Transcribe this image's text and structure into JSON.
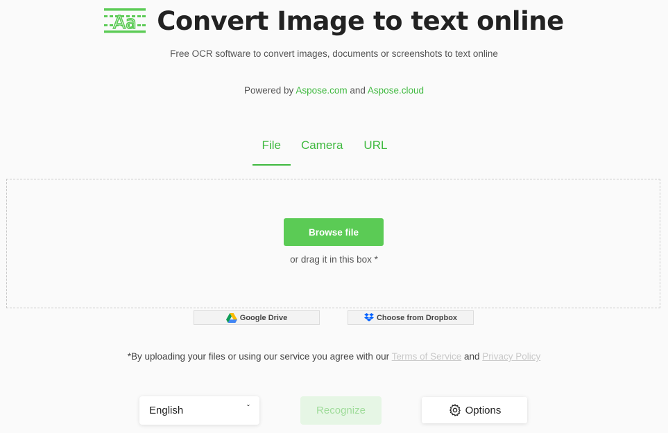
{
  "header": {
    "title": "Convert Image to text online",
    "subtitle": "Free OCR software to convert images, documents or screenshots to text online",
    "logo_icon": "ocr-aa-icon",
    "logo_text": "Aa",
    "brand_color": "#3fb93f"
  },
  "powered": {
    "prefix": "Powered by",
    "link1": "Aspose.com",
    "conj": "and",
    "link2": "Aspose.cloud"
  },
  "tabs": [
    {
      "label": "File",
      "active": true
    },
    {
      "label": "Camera",
      "active": false
    },
    {
      "label": "URL",
      "active": false
    }
  ],
  "dropzone": {
    "browse_label": "Browse file",
    "hint": "or drag it in this box *",
    "button_color": "#5bcb55"
  },
  "cloud": {
    "google_drive_label": "Google Drive",
    "google_drive_icon": "google-drive-icon",
    "dropbox_label": "Choose from Dropbox",
    "dropbox_icon": "dropbox-icon"
  },
  "terms": {
    "prefix": "*By uploading your files or using our service you agree with our",
    "tos": "Terms of Service",
    "conj": "and",
    "privacy": "Privacy Policy"
  },
  "controls": {
    "language": "English",
    "language_icon": "chevron-down-icon",
    "recognize_label": "Recognize",
    "options_label": "Options",
    "options_icon": "gear-icon"
  }
}
